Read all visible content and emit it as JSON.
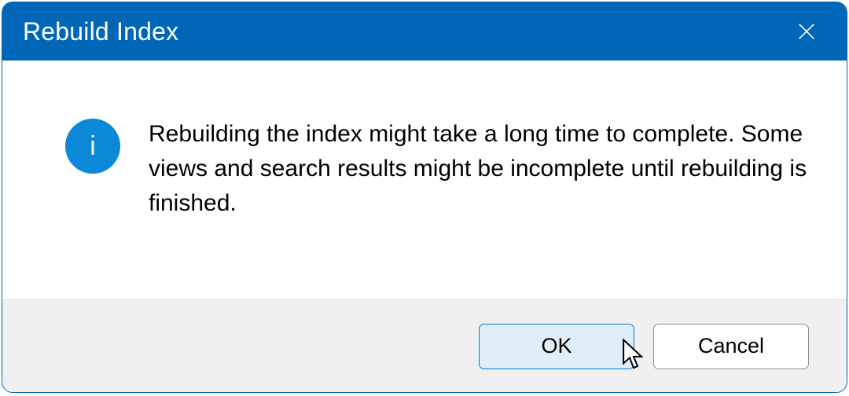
{
  "dialog": {
    "title": "Rebuild Index",
    "message": "Rebuilding the index might take a long time to complete. Some views and search results might be incomplete until rebuilding is finished.",
    "info_glyph": "i",
    "buttons": {
      "ok": "OK",
      "cancel": "Cancel"
    }
  }
}
